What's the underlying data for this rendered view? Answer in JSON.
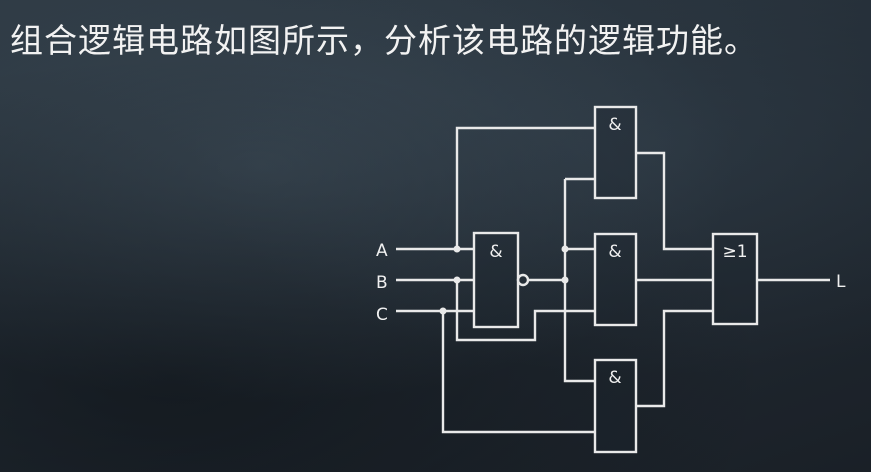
{
  "question": "组合逻辑电路如图所示，分析该电路的逻辑功能。",
  "inputs": [
    "A",
    "B",
    "C"
  ],
  "output": "L",
  "gates": {
    "nand_symbol": "&",
    "and_top_symbol": "&",
    "and_mid_symbol": "&",
    "and_bot_symbol": "&",
    "or_symbol": "≥1"
  }
}
